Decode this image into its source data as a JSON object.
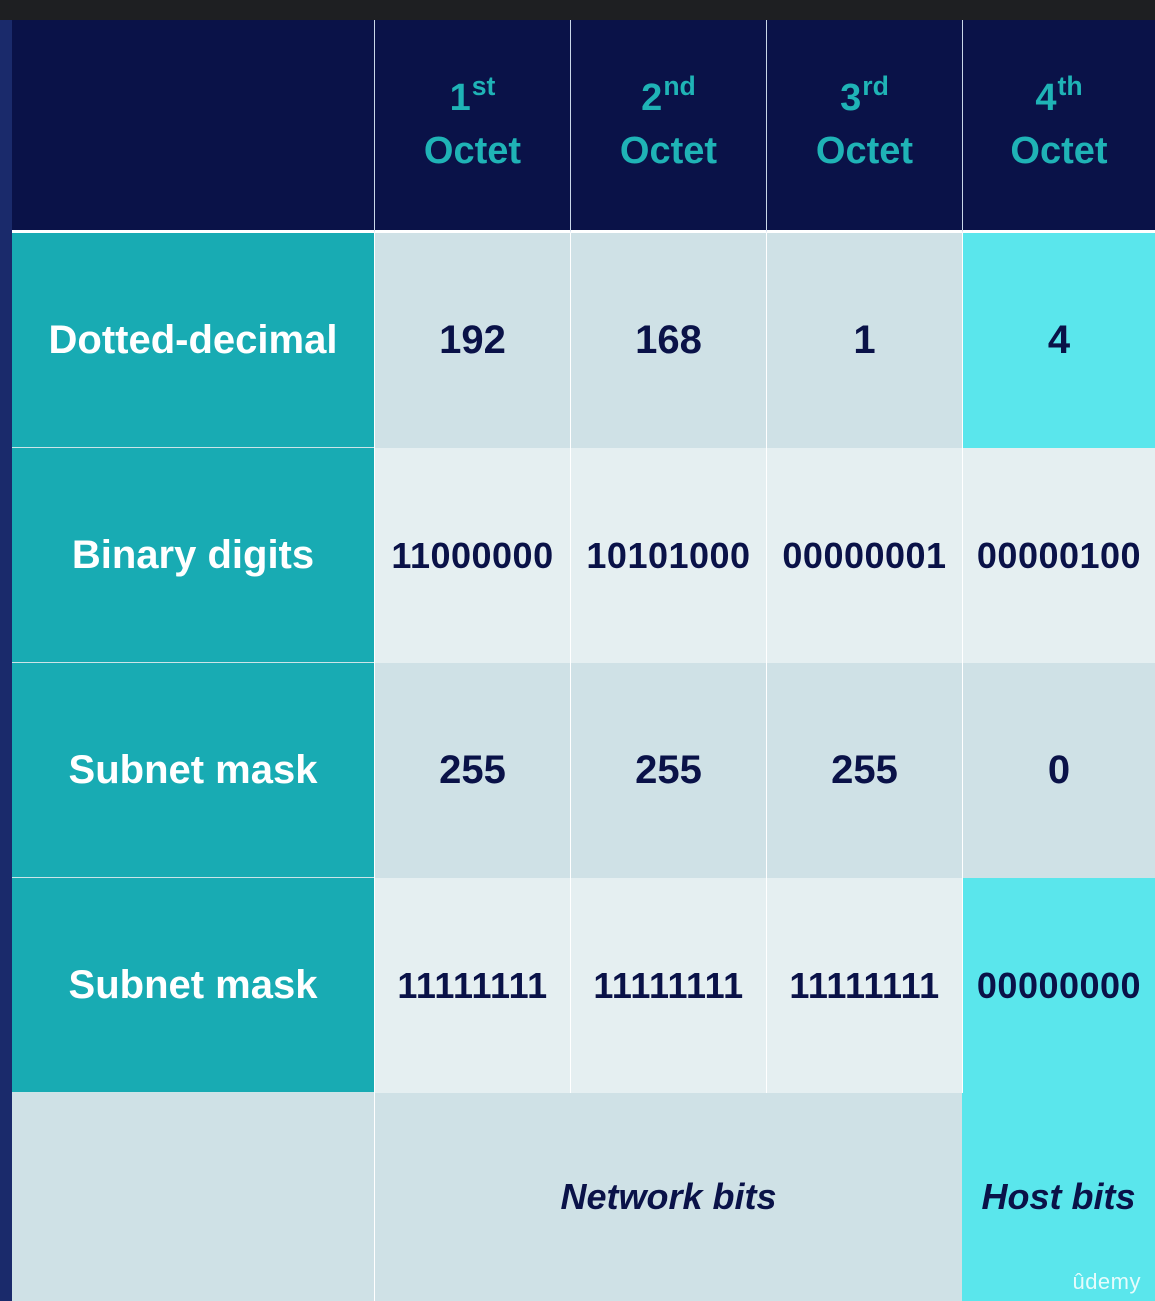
{
  "header": {
    "columns": [
      {
        "num": "1",
        "suffix": "st",
        "word": "Octet"
      },
      {
        "num": "2",
        "suffix": "nd",
        "word": "Octet"
      },
      {
        "num": "3",
        "suffix": "rd",
        "word": "Octet"
      },
      {
        "num": "4",
        "suffix": "th",
        "word": "Octet"
      }
    ]
  },
  "rows": [
    {
      "label": "Dotted-decimal",
      "values": [
        "192",
        "168",
        "1",
        "4"
      ]
    },
    {
      "label": "Binary digits",
      "values": [
        "11000000",
        "10101000",
        "00000001",
        "00000100"
      ]
    },
    {
      "label": "Subnet mask",
      "values": [
        "255",
        "255",
        "255",
        "0"
      ]
    },
    {
      "label": "Subnet mask",
      "values": [
        "11111111",
        "11111111",
        "11111111",
        "00000000"
      ]
    }
  ],
  "footer": {
    "network_label": "Network bits",
    "host_label": "Host bits"
  },
  "watermark": "ûdemy",
  "colors": {
    "header_bg": "#0a1248",
    "header_text": "#1fb3b6",
    "row_label_bg": "#18abb3",
    "cell_dark": "#cfe1e6",
    "cell_light": "#e5eff1",
    "highlight": "#5ae6ec"
  }
}
